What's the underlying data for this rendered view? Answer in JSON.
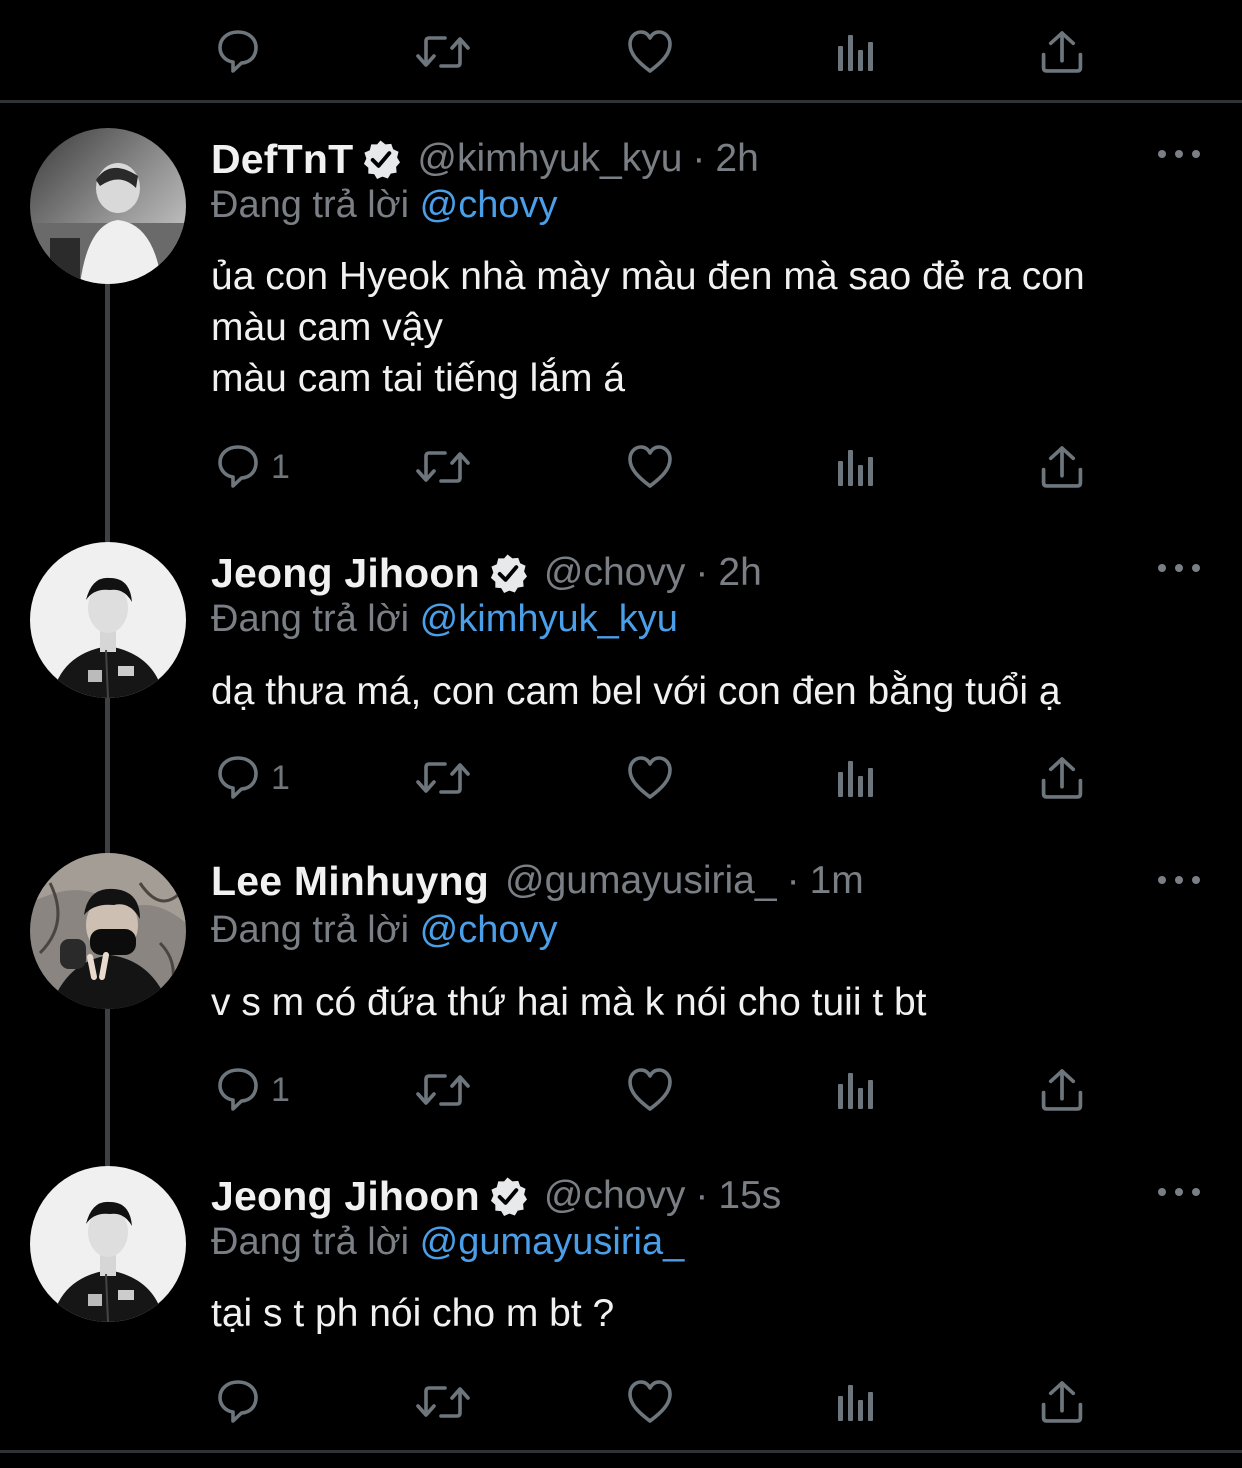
{
  "reply_prefix": "Đang trả lời",
  "colors": {
    "background": "#000000",
    "mention": "#4a9fe8",
    "muted": "#7a7f85",
    "divider": "#2f3336"
  },
  "top_actions": {
    "reply_count": "",
    "retweet_count": "",
    "like_count": ""
  },
  "tweets": [
    {
      "name": "DefTnT",
      "verified": true,
      "handle": "@kimhyuk_kyu",
      "separator": "·",
      "time": "2h",
      "reply_to": "@chovy",
      "lines": [
        "ủa con Hyeok nhà mày màu đen mà sao đẻ ra con",
        "màu cam vậy",
        "màu cam tai tiếng lắm á"
      ],
      "reply_count": "1",
      "avatar": "person-in-white-shirt-photo"
    },
    {
      "name": "Jeong Jihoon",
      "verified": true,
      "handle": "@chovy",
      "separator": "·",
      "time": "2h",
      "reply_to": "@kimhyuk_kyu",
      "lines": [
        "dạ thưa má, con cam bel với con đen bằng tuổi ạ"
      ],
      "reply_count": "1",
      "avatar": "person-in-gen-g-jacket-photo"
    },
    {
      "name": "Lee Minhuyng",
      "verified": false,
      "handle": "@gumayusiria_",
      "separator": "·",
      "time": "1m",
      "reply_to": "@chovy",
      "lines": [
        "v s m có đứa thứ hai mà k nói cho tuii t bt"
      ],
      "reply_count": "1",
      "avatar": "person-with-black-mask-photo"
    },
    {
      "name": "Jeong Jihoon",
      "verified": true,
      "handle": "@chovy",
      "separator": "·",
      "time": "15s",
      "reply_to": "@gumayusiria_",
      "lines": [
        "tại s t ph nói cho m bt ?"
      ],
      "reply_count": "",
      "avatar": "person-in-gen-g-jacket-photo"
    }
  ]
}
